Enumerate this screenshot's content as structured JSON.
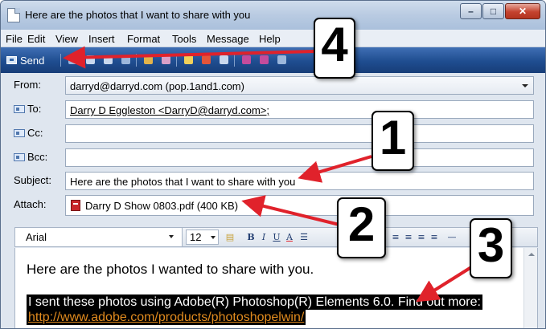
{
  "window": {
    "title": "Here are the photos that I want to share with you",
    "controls": {
      "minimize": "–",
      "maximize": "□",
      "close": "✕"
    }
  },
  "menu": [
    "File",
    "Edit",
    "View",
    "Insert",
    "Format",
    "Tools",
    "Message",
    "Help"
  ],
  "toolbar": {
    "send_label": "Send"
  },
  "headers": {
    "from_label": "From:",
    "from_value": "darryd@darryd.com   (pop.1and1.com)",
    "to_label": "To:",
    "to_value": "Darry D Eggleston <DarryD@darryd.com>;",
    "cc_label": "Cc:",
    "cc_value": "",
    "bcc_label": "Bcc:",
    "bcc_value": "",
    "subject_label": "Subject:",
    "subject_value": "Here are the photos that I want to share with you",
    "attach_label": "Attach:",
    "attachment": "Darry D Show 0803.pdf (400 KB)"
  },
  "format_bar": {
    "font": "Arial",
    "size": "12",
    "bold": "B",
    "italic": "I",
    "underline": "U",
    "font_color": "A"
  },
  "message": {
    "line1": "Here are the photos I wanted to share with you.",
    "line2": "I sent these photos using Adobe(R) Photoshop(R) Elements 6.0. Find out more:",
    "link": "http://www.adobe.com/products/photoshopelwin/"
  },
  "callouts": [
    "1",
    "2",
    "3",
    "4"
  ],
  "colors": {
    "toolbar": "#1f4d90",
    "arrow": "#e0222b",
    "highlight": "#000000",
    "link": "#e08a1e"
  }
}
